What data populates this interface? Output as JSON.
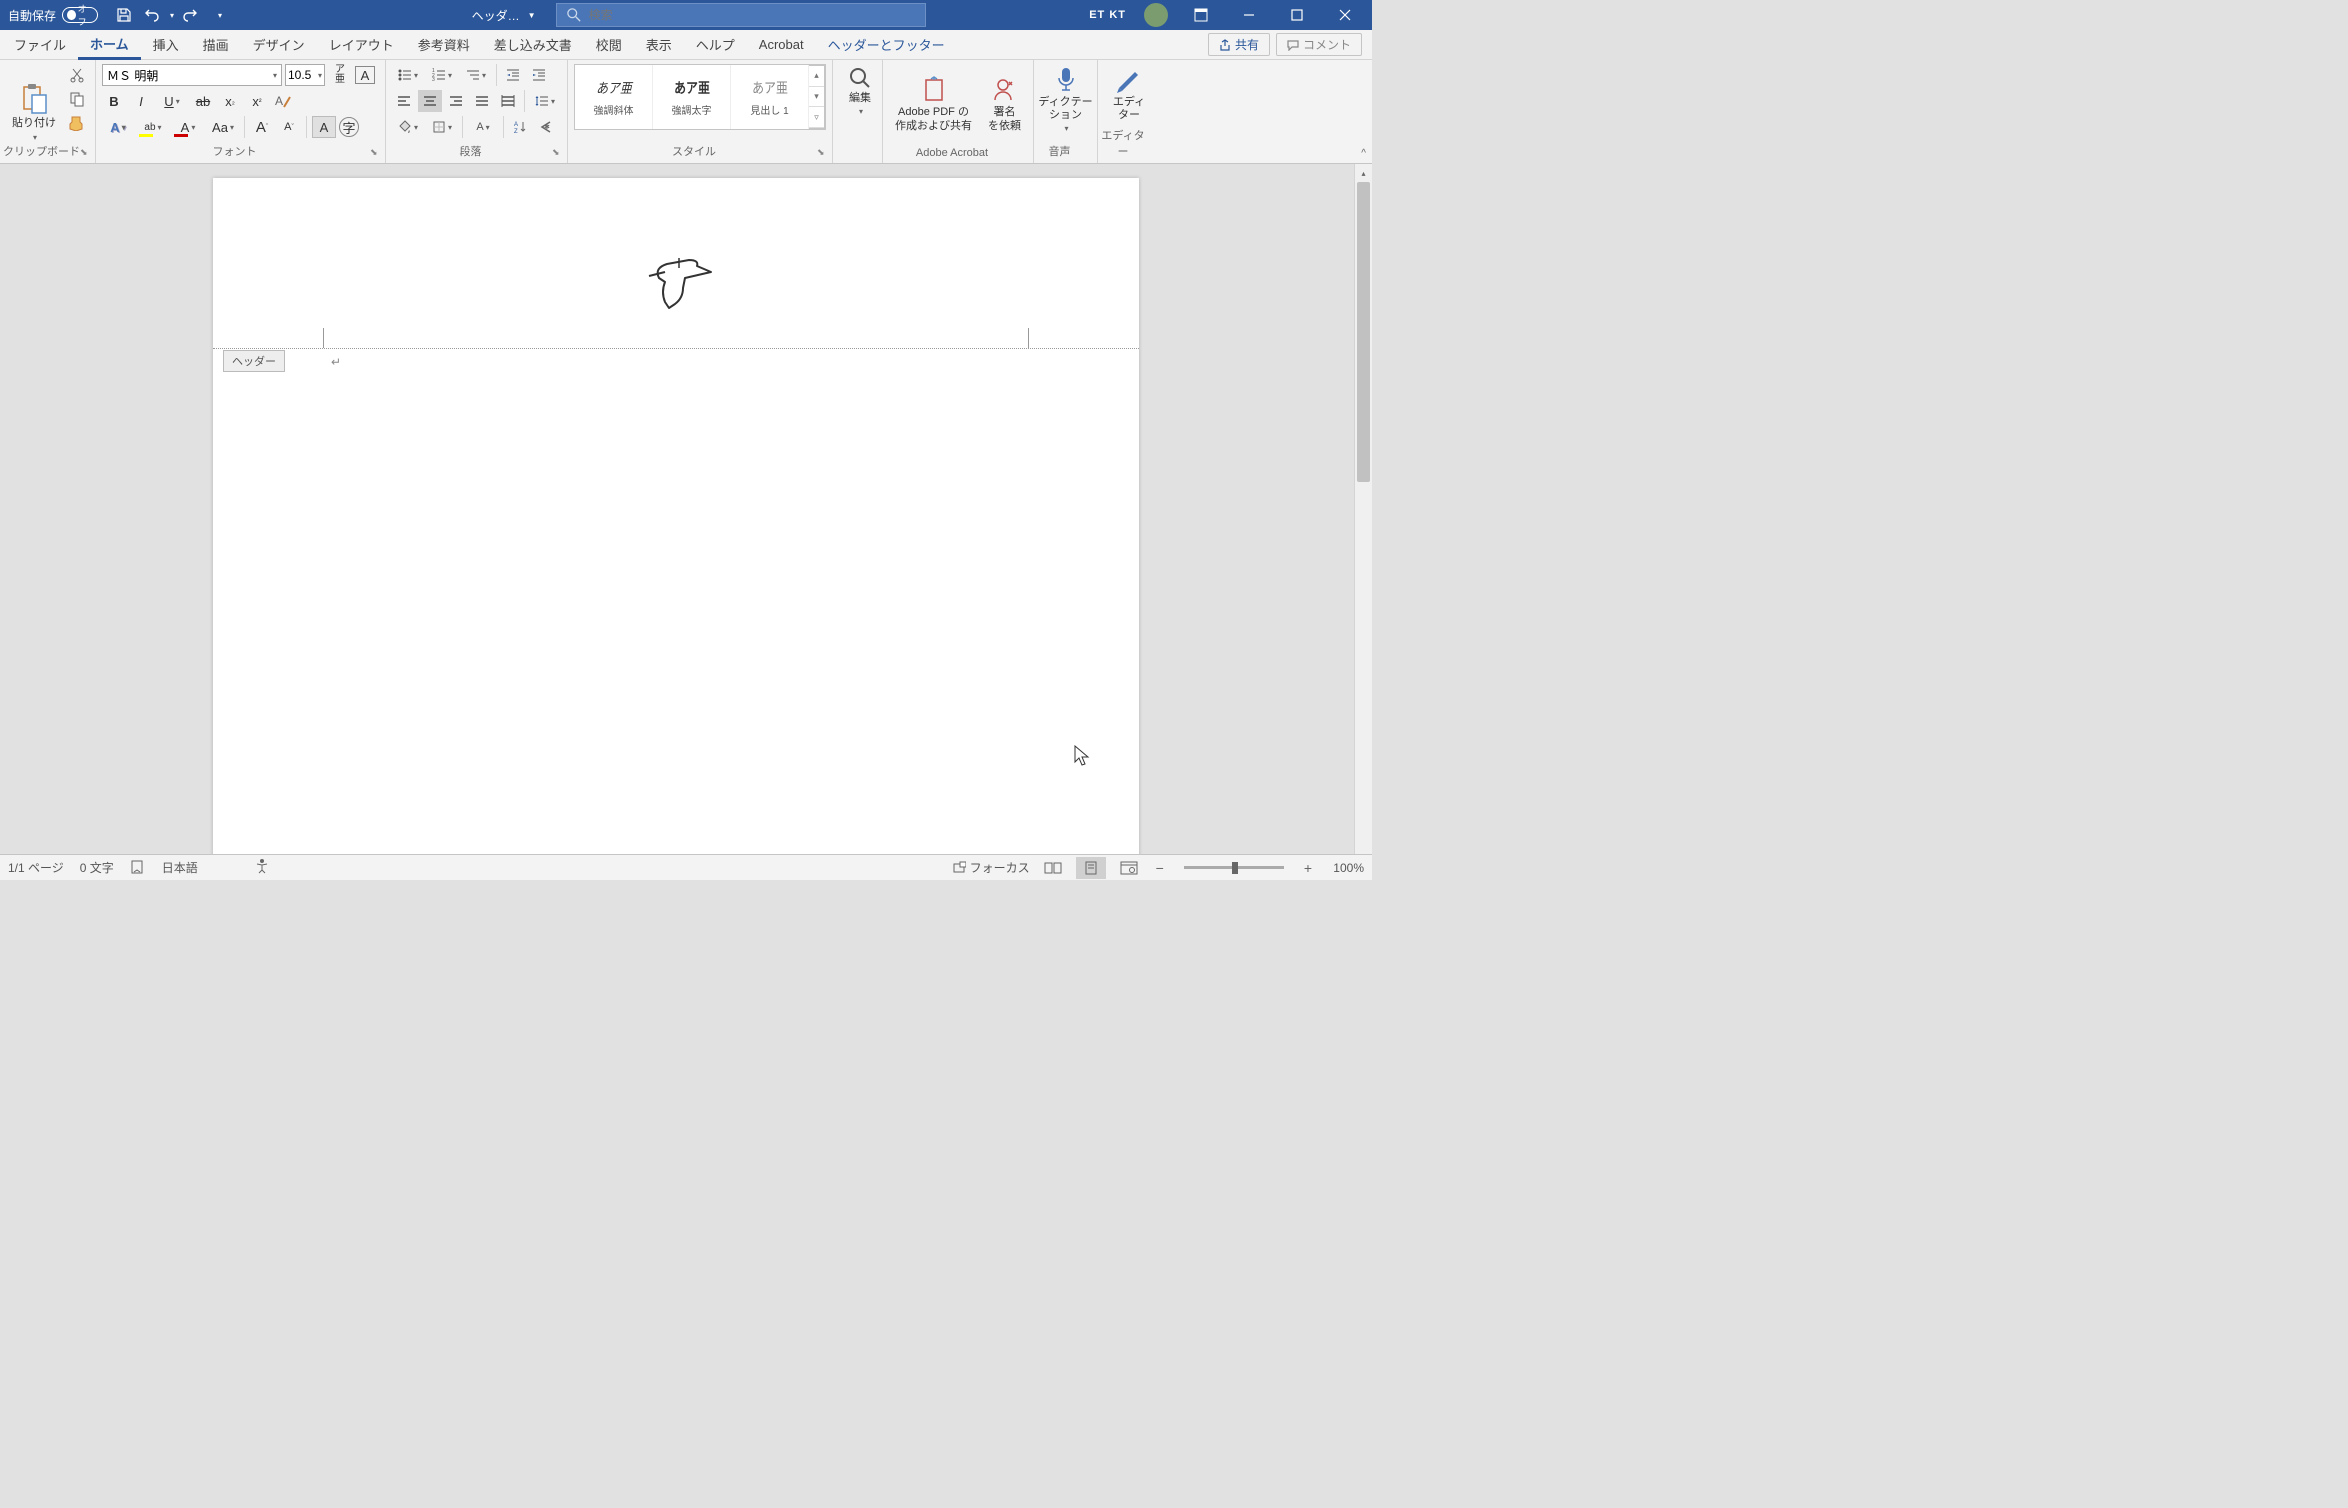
{
  "titleBar": {
    "autoSave": "自動保存",
    "autoSaveState": "オフ",
    "docTitle": "ヘッダ…",
    "searchPlaceholder": "検索",
    "brand": "ET KT"
  },
  "tabs": {
    "file": "ファイル",
    "home": "ホーム",
    "insert": "挿入",
    "draw": "描画",
    "design": "デザイン",
    "layout": "レイアウト",
    "references": "参考資料",
    "mailings": "差し込み文書",
    "review": "校閲",
    "view": "表示",
    "help": "ヘルプ",
    "acrobat": "Acrobat",
    "headerFooter": "ヘッダーとフッター",
    "share": "共有",
    "comments": "コメント"
  },
  "ribbon": {
    "clipboard": {
      "paste": "貼り付け",
      "label": "クリップボード"
    },
    "font": {
      "name": "ＭＳ 明朝",
      "size": "10.5",
      "label": "フォント"
    },
    "paragraph": {
      "label": "段落"
    },
    "styles": {
      "label": "スタイル",
      "items": [
        {
          "preview": "あア亜",
          "name": "強調斜体",
          "italic": true
        },
        {
          "preview": "あア亜",
          "name": "強調太字",
          "bold": true
        },
        {
          "preview": "あア亜",
          "name": "見出し 1",
          "light": true
        }
      ]
    },
    "editing": {
      "label": "編集"
    },
    "acrobat": {
      "pdf": "Adobe PDF の\n作成および共有",
      "sign": "署名\nを依頼",
      "label": "Adobe Acrobat"
    },
    "voice": {
      "dictate": "ディクテー\nション",
      "label": "音声"
    },
    "editor": {
      "btn": "エディ\nター",
      "label": "エディター"
    }
  },
  "document": {
    "headerTag": "ヘッダー"
  },
  "statusBar": {
    "page": "1/1 ページ",
    "words": "0 文字",
    "language": "日本語",
    "focus": "フォーカス",
    "zoom": "100%"
  }
}
